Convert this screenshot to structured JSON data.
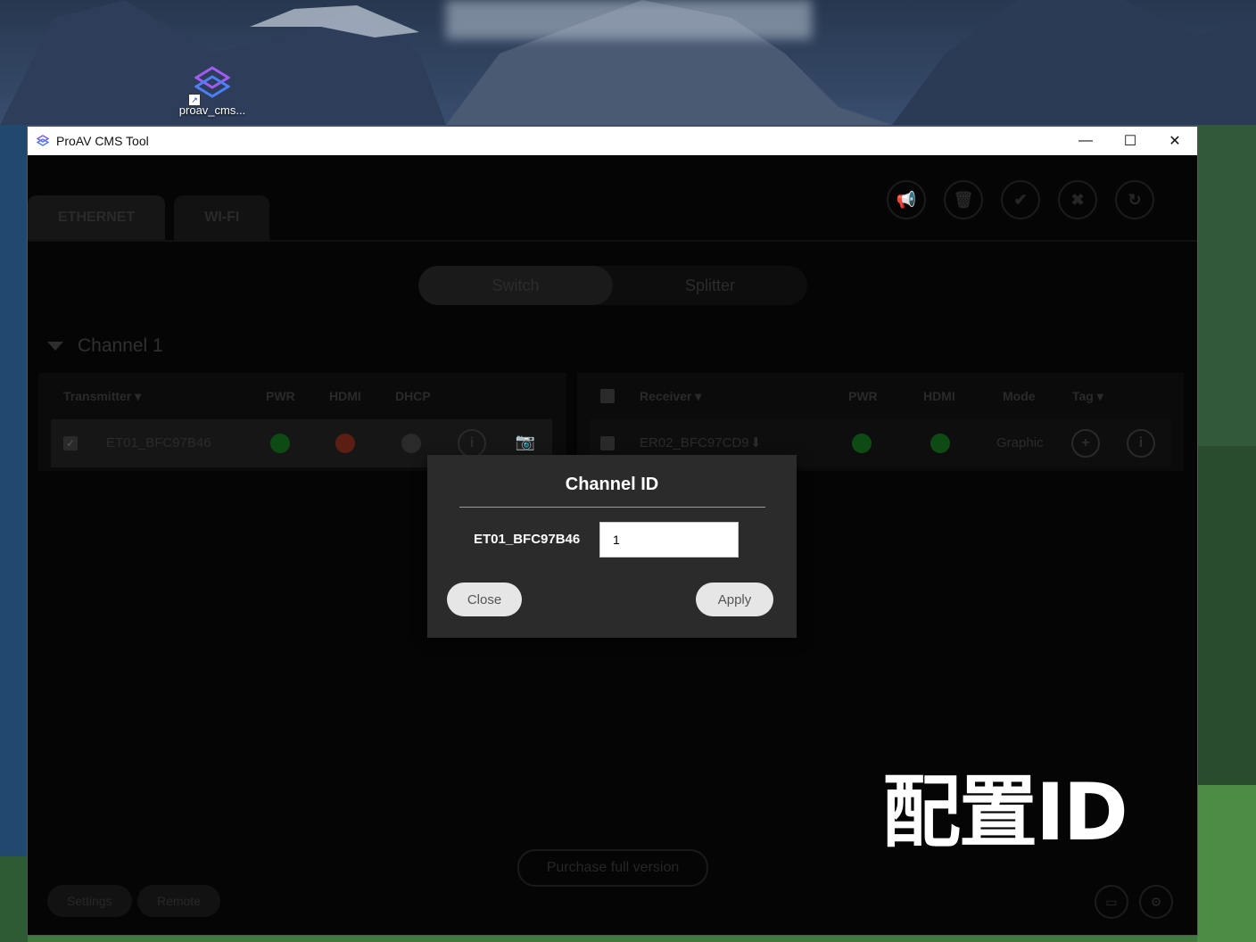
{
  "desktop": {
    "icon_label": "proav_cms..."
  },
  "window": {
    "title": "ProAV CMS Tool",
    "controls": {
      "minimize": "—",
      "maximize": "☐",
      "close": "✕"
    }
  },
  "tabs": [
    "ETHERNET",
    "WI-FI"
  ],
  "toolbar_icons": [
    "megaphone-icon",
    "trash-icon",
    "check-icon",
    "close-icon",
    "refresh-icon"
  ],
  "mode_switch": {
    "switch": "Switch",
    "splitter": "Splitter"
  },
  "channel": {
    "title": "Channel 1"
  },
  "transmitter_table": {
    "headers": {
      "name": "Transmitter",
      "pwr": "PWR",
      "hdmi": "HDMI",
      "dhcp": "DHCP"
    },
    "row": {
      "name": "ET01_BFC97B46",
      "checked": true,
      "pwr_color": "#0e4a14",
      "hdmi_color": "#5a1f12",
      "dhcp_color": "#2a2a2a"
    }
  },
  "receiver_table": {
    "headers": {
      "name": "Receiver",
      "pwr": "PWR",
      "hdmi": "HDMI",
      "mode": "Mode",
      "tag": "Tag"
    },
    "row": {
      "name": "ER02_BFC97CD9",
      "pwr_color": "#0e4a14",
      "hdmi_color": "#0e4a14",
      "mode": "Graphic"
    }
  },
  "purchase_label": "Purchase full version",
  "bottom": {
    "settings": "Settings",
    "remote": "Remote"
  },
  "overlay_caption": "配置ID",
  "dialog": {
    "title": "Channel ID",
    "device_label": "ET01_BFC97B46",
    "input_value": "1",
    "close_label": "Close",
    "apply_label": "Apply"
  }
}
